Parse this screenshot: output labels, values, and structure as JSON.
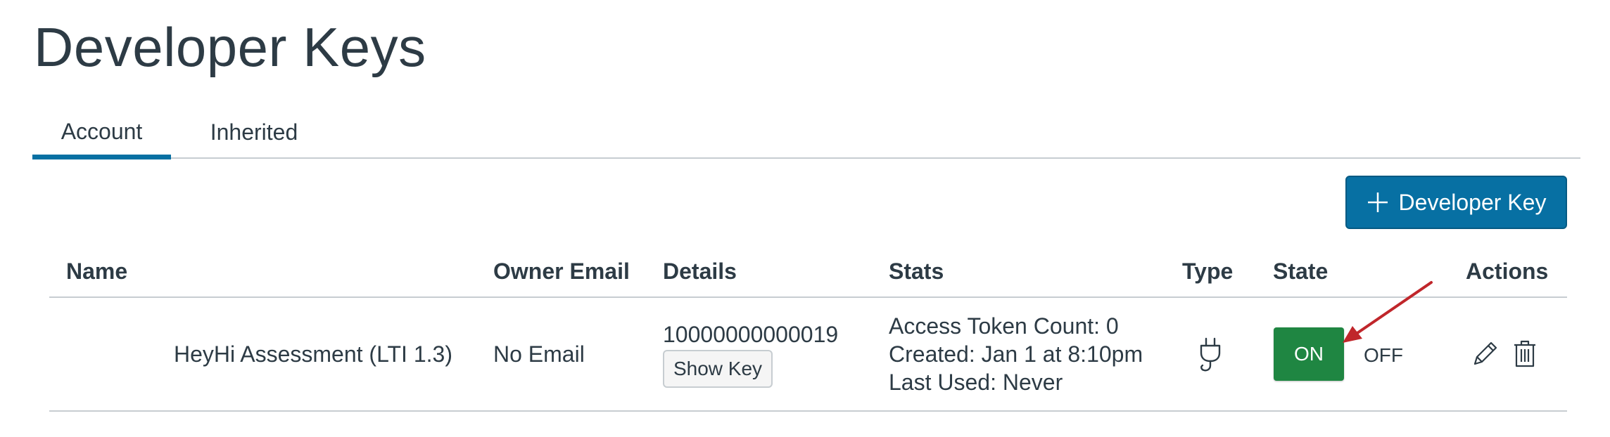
{
  "page": {
    "title": "Developer Keys"
  },
  "tabs": [
    {
      "label": "Account",
      "active": true
    },
    {
      "label": "Inherited",
      "active": false
    }
  ],
  "toolbar": {
    "add_button_label": "Developer Key",
    "add_icon": "plus-icon"
  },
  "table": {
    "headers": {
      "name": "Name",
      "owner_email": "Owner Email",
      "details": "Details",
      "stats": "Stats",
      "type": "Type",
      "state": "State",
      "actions": "Actions"
    },
    "rows": [
      {
        "name": "HeyHi Assessment (LTI 1.3)",
        "owner_email": "No Email",
        "key_id": "10000000000019",
        "show_key_label": "Show Key",
        "stats": {
          "access_token_count": "Access Token Count: 0",
          "created": "Created: Jan 1 at 8:10pm",
          "last_used": "Last Used: Never"
        },
        "type_icon": "plug-icon",
        "state_on_label": "ON",
        "state_off_label": "OFF",
        "state": "on",
        "actions": [
          "edit-icon",
          "trash-icon"
        ]
      }
    ]
  },
  "colors": {
    "primary": "#0770a3",
    "state_on": "#1f8642",
    "text": "#2d3b45",
    "divider": "#c7cdd1",
    "annotation_arrow": "#c0262b"
  }
}
